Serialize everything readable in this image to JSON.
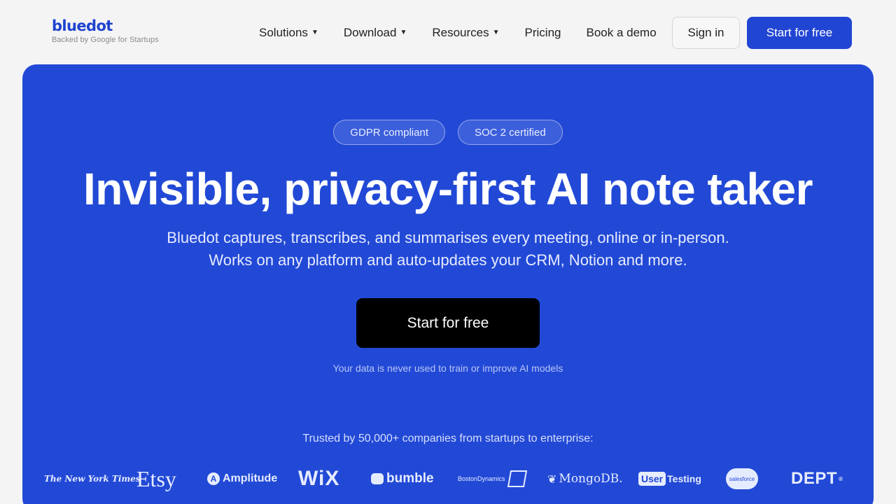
{
  "header": {
    "logo": "bluedot",
    "logo_sub": "Backed by Google for Startups",
    "nav": [
      {
        "label": "Solutions",
        "has_caret": true
      },
      {
        "label": "Download",
        "has_caret": true
      },
      {
        "label": "Resources",
        "has_caret": true
      },
      {
        "label": "Pricing",
        "has_caret": false
      },
      {
        "label": "Book a demo",
        "has_caret": false
      }
    ],
    "sign_in": "Sign in",
    "start_free": "Start for free"
  },
  "hero": {
    "badges": [
      "GDPR compliant",
      "SOC 2 certified"
    ],
    "title": "Invisible, privacy-first AI note taker",
    "subtitle_line1": "Bluedot captures, transcribes, and summarises every meeting, online or in-person.",
    "subtitle_line2": "Works on any platform and auto-updates your CRM, Notion and more.",
    "cta": "Start for free",
    "note": "Your data is never used to train or improve AI models",
    "trusted": "Trusted by 50,000+ companies from startups to enterprise:"
  },
  "logos": {
    "nyt": "The New York Times",
    "etsy": "Etsy",
    "amplitude": "Amplitude",
    "wix": "WiX",
    "bumble": "bumble",
    "boston": "BostonDynamics",
    "mongodb": "MongoDB.",
    "usertesting_box": "User",
    "usertesting_rest": "Testing",
    "salesforce": "salesforce",
    "dept": "DEPT"
  },
  "colors": {
    "brand_blue": "#2249d6",
    "button_blue": "#2145d3",
    "page_bg": "#f4f4f5",
    "cta_black": "#000000"
  }
}
